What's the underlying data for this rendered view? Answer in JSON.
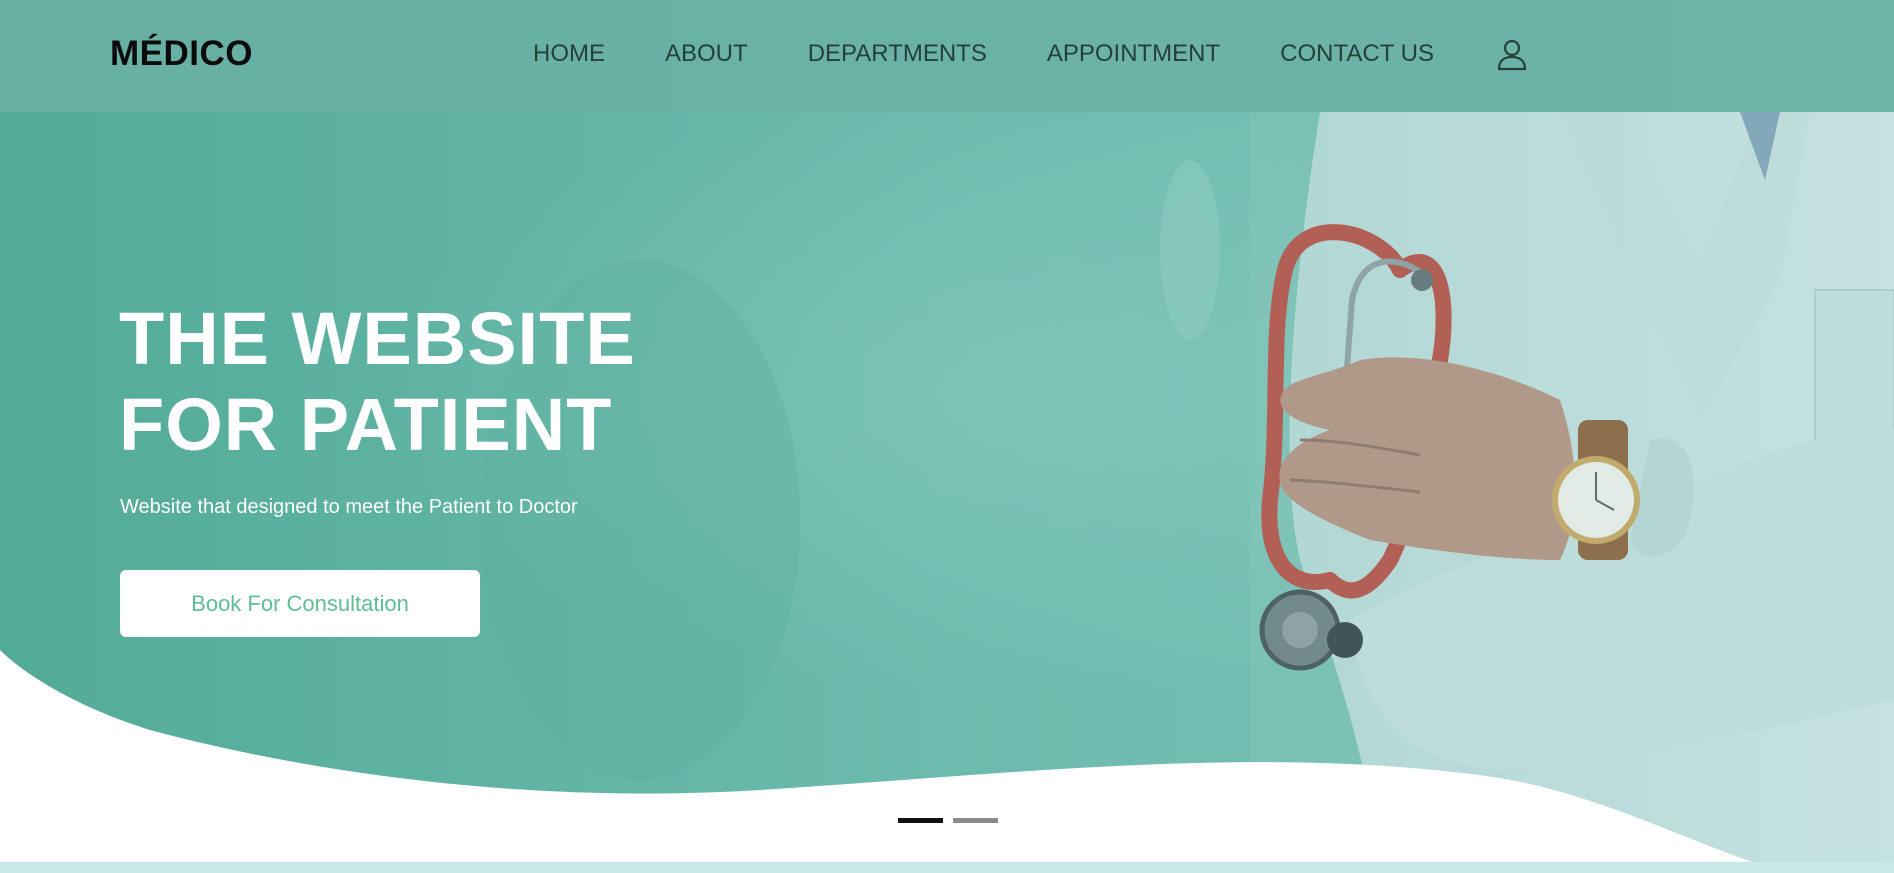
{
  "brand": {
    "logo": "MÉDICO"
  },
  "nav": {
    "items": [
      {
        "label": "HOME"
      },
      {
        "label": "ABOUT"
      },
      {
        "label": "DEPARTMENTS"
      },
      {
        "label": "APPOINTMENT"
      },
      {
        "label": "CONTACT US"
      }
    ],
    "user_icon": "user-icon"
  },
  "hero": {
    "title_line1": "THE WEBSITE",
    "title_line2": "FOR PATIENT",
    "subtitle": "Website that designed to meet the Patient to Doctor",
    "cta_label": "Book For Consultation"
  },
  "slider": {
    "slides": 2,
    "active": 0
  },
  "colors": {
    "teal": "#5fb4a2",
    "nav_bg": "#7bb9b1",
    "cta_text": "#5fbf94",
    "strip": "#c9e8ea"
  }
}
